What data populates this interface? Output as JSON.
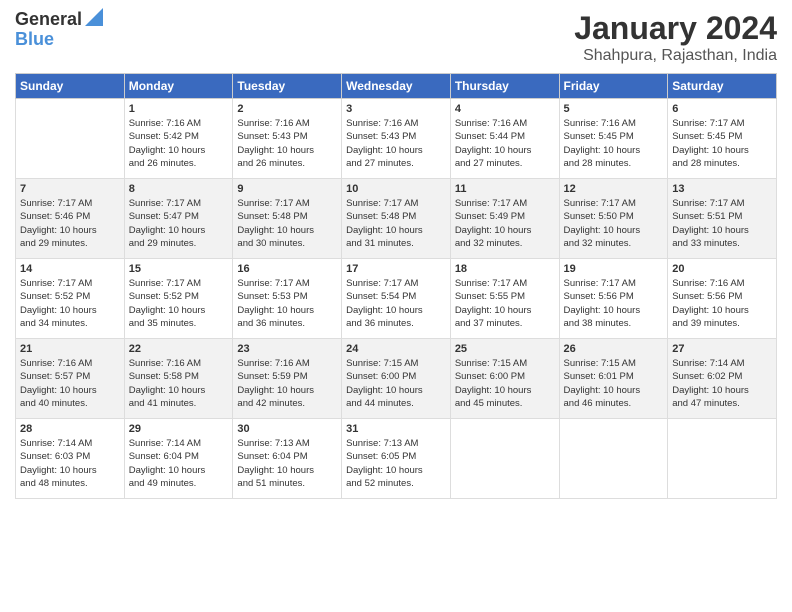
{
  "header": {
    "logo_line1": "General",
    "logo_line2": "Blue",
    "title": "January 2024",
    "subtitle": "Shahpura, Rajasthan, India"
  },
  "days_of_week": [
    "Sunday",
    "Monday",
    "Tuesday",
    "Wednesday",
    "Thursday",
    "Friday",
    "Saturday"
  ],
  "weeks": [
    [
      {
        "day": "",
        "info": ""
      },
      {
        "day": "1",
        "info": "Sunrise: 7:16 AM\nSunset: 5:42 PM\nDaylight: 10 hours\nand 26 minutes."
      },
      {
        "day": "2",
        "info": "Sunrise: 7:16 AM\nSunset: 5:43 PM\nDaylight: 10 hours\nand 26 minutes."
      },
      {
        "day": "3",
        "info": "Sunrise: 7:16 AM\nSunset: 5:43 PM\nDaylight: 10 hours\nand 27 minutes."
      },
      {
        "day": "4",
        "info": "Sunrise: 7:16 AM\nSunset: 5:44 PM\nDaylight: 10 hours\nand 27 minutes."
      },
      {
        "day": "5",
        "info": "Sunrise: 7:16 AM\nSunset: 5:45 PM\nDaylight: 10 hours\nand 28 minutes."
      },
      {
        "day": "6",
        "info": "Sunrise: 7:17 AM\nSunset: 5:45 PM\nDaylight: 10 hours\nand 28 minutes."
      }
    ],
    [
      {
        "day": "7",
        "info": "Sunrise: 7:17 AM\nSunset: 5:46 PM\nDaylight: 10 hours\nand 29 minutes."
      },
      {
        "day": "8",
        "info": "Sunrise: 7:17 AM\nSunset: 5:47 PM\nDaylight: 10 hours\nand 29 minutes."
      },
      {
        "day": "9",
        "info": "Sunrise: 7:17 AM\nSunset: 5:48 PM\nDaylight: 10 hours\nand 30 minutes."
      },
      {
        "day": "10",
        "info": "Sunrise: 7:17 AM\nSunset: 5:48 PM\nDaylight: 10 hours\nand 31 minutes."
      },
      {
        "day": "11",
        "info": "Sunrise: 7:17 AM\nSunset: 5:49 PM\nDaylight: 10 hours\nand 32 minutes."
      },
      {
        "day": "12",
        "info": "Sunrise: 7:17 AM\nSunset: 5:50 PM\nDaylight: 10 hours\nand 32 minutes."
      },
      {
        "day": "13",
        "info": "Sunrise: 7:17 AM\nSunset: 5:51 PM\nDaylight: 10 hours\nand 33 minutes."
      }
    ],
    [
      {
        "day": "14",
        "info": "Sunrise: 7:17 AM\nSunset: 5:52 PM\nDaylight: 10 hours\nand 34 minutes."
      },
      {
        "day": "15",
        "info": "Sunrise: 7:17 AM\nSunset: 5:52 PM\nDaylight: 10 hours\nand 35 minutes."
      },
      {
        "day": "16",
        "info": "Sunrise: 7:17 AM\nSunset: 5:53 PM\nDaylight: 10 hours\nand 36 minutes."
      },
      {
        "day": "17",
        "info": "Sunrise: 7:17 AM\nSunset: 5:54 PM\nDaylight: 10 hours\nand 36 minutes."
      },
      {
        "day": "18",
        "info": "Sunrise: 7:17 AM\nSunset: 5:55 PM\nDaylight: 10 hours\nand 37 minutes."
      },
      {
        "day": "19",
        "info": "Sunrise: 7:17 AM\nSunset: 5:56 PM\nDaylight: 10 hours\nand 38 minutes."
      },
      {
        "day": "20",
        "info": "Sunrise: 7:16 AM\nSunset: 5:56 PM\nDaylight: 10 hours\nand 39 minutes."
      }
    ],
    [
      {
        "day": "21",
        "info": "Sunrise: 7:16 AM\nSunset: 5:57 PM\nDaylight: 10 hours\nand 40 minutes."
      },
      {
        "day": "22",
        "info": "Sunrise: 7:16 AM\nSunset: 5:58 PM\nDaylight: 10 hours\nand 41 minutes."
      },
      {
        "day": "23",
        "info": "Sunrise: 7:16 AM\nSunset: 5:59 PM\nDaylight: 10 hours\nand 42 minutes."
      },
      {
        "day": "24",
        "info": "Sunrise: 7:15 AM\nSunset: 6:00 PM\nDaylight: 10 hours\nand 44 minutes."
      },
      {
        "day": "25",
        "info": "Sunrise: 7:15 AM\nSunset: 6:00 PM\nDaylight: 10 hours\nand 45 minutes."
      },
      {
        "day": "26",
        "info": "Sunrise: 7:15 AM\nSunset: 6:01 PM\nDaylight: 10 hours\nand 46 minutes."
      },
      {
        "day": "27",
        "info": "Sunrise: 7:14 AM\nSunset: 6:02 PM\nDaylight: 10 hours\nand 47 minutes."
      }
    ],
    [
      {
        "day": "28",
        "info": "Sunrise: 7:14 AM\nSunset: 6:03 PM\nDaylight: 10 hours\nand 48 minutes."
      },
      {
        "day": "29",
        "info": "Sunrise: 7:14 AM\nSunset: 6:04 PM\nDaylight: 10 hours\nand 49 minutes."
      },
      {
        "day": "30",
        "info": "Sunrise: 7:13 AM\nSunset: 6:04 PM\nDaylight: 10 hours\nand 51 minutes."
      },
      {
        "day": "31",
        "info": "Sunrise: 7:13 AM\nSunset: 6:05 PM\nDaylight: 10 hours\nand 52 minutes."
      },
      {
        "day": "",
        "info": ""
      },
      {
        "day": "",
        "info": ""
      },
      {
        "day": "",
        "info": ""
      }
    ]
  ]
}
